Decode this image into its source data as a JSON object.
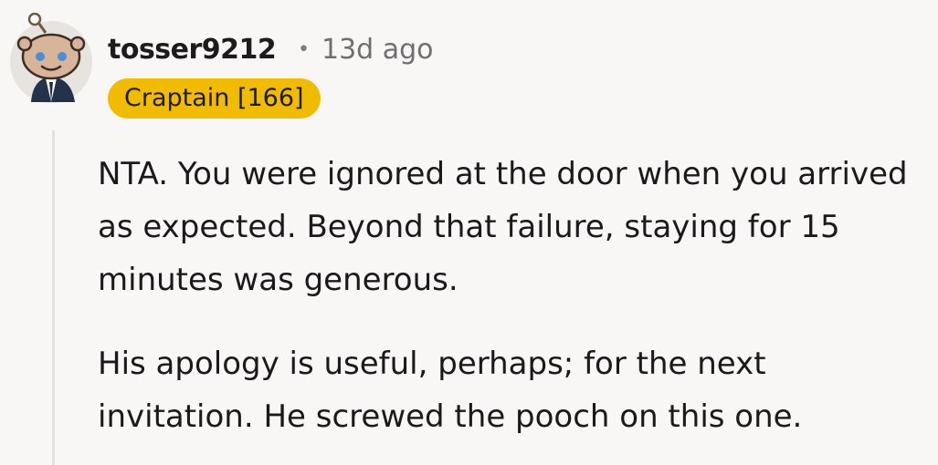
{
  "comment": {
    "author": "tosser9212",
    "separator": "•",
    "time_ago": "13d ago",
    "flair": "Craptain [166]",
    "paragraphs": [
      "NTA. You were ignored at the door when you arrived as expected. Beyond that failure, staying for 15 minutes was generous.",
      "His apology is useful, perhaps; for the next invitation. He screwed the pooch on this one."
    ]
  },
  "colors": {
    "background": "#f8f7f6",
    "flair_bg": "#f1bc00",
    "thread_line": "#e4e2e0",
    "meta_text": "#6f6f6f"
  },
  "icons": {
    "avatar": "snoo-avatar-icon"
  }
}
